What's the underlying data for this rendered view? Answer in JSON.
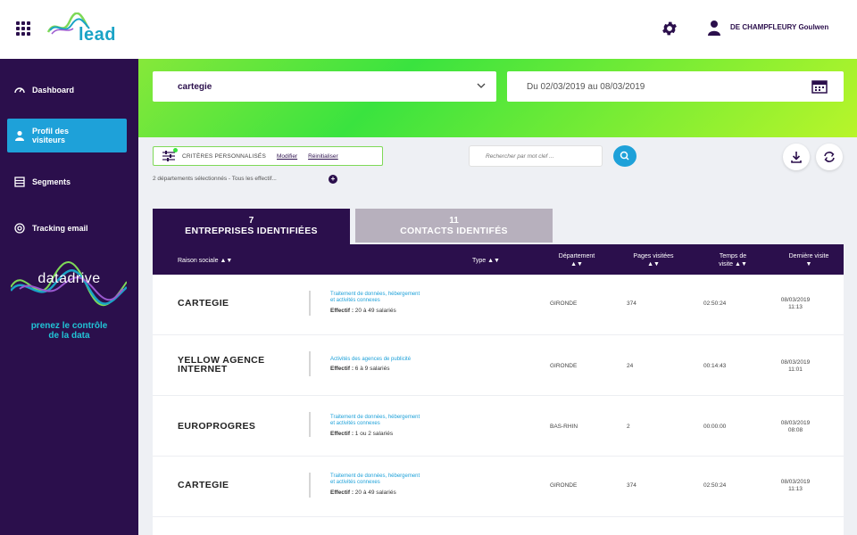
{
  "header": {
    "logo_text": "lead",
    "user_name": "DE CHAMPFLEURY Goulwen"
  },
  "sidebar": {
    "items": [
      {
        "label": "Dashboard",
        "icon": "gauge-icon"
      },
      {
        "label": "Profil des visiteurs",
        "icon": "user-icon",
        "active": true
      },
      {
        "label": "Segments",
        "icon": "segments-icon"
      },
      {
        "label": "Tracking email",
        "icon": "at-icon"
      }
    ],
    "brand": "datadrive",
    "tagline_1": "prenez le contrôle",
    "tagline_2": "de la data"
  },
  "filters": {
    "company_select": "cartegie",
    "date_range": "Du 02/03/2019 au 08/03/2019",
    "criteria_label": "CRITÈRES PERSONNALISÉS",
    "modify": "Modifier",
    "reset": "Réinitialiser",
    "summary": "2 départements sélectionnés - Tous les effectif...",
    "search_placeholder": "Rechercher par mot clef ..."
  },
  "tabs": [
    {
      "count": "7",
      "label": "ENTREPRISES IDENTIFIÉES",
      "active": true
    },
    {
      "count": "11",
      "label": "CONTACTS IDENTIFÉS",
      "active": false
    }
  ],
  "table": {
    "headers": {
      "name": "Raison sociale ▲▼",
      "type": "Type ▲▼",
      "dept_1": "Département",
      "dept_2": "▲▼",
      "pages_1": "Pages visitées",
      "pages_2": "▲▼",
      "time_1": "Temps de",
      "time_2": "visite ▲▼",
      "last_1": "Dernière visite",
      "last_2": "▼"
    },
    "effectif_label": "Effectif :",
    "rows": [
      {
        "name_1": "CARTEGIE",
        "name_2": "",
        "sector_1": "Traitement de données, hébergement",
        "sector_2": "et activités connexes",
        "effectif": " 20 à 49 salariés",
        "dept": "GIRONDE",
        "pages": "374",
        "time": "02:50:24",
        "date": "08/03/2019",
        "hour": "11:13"
      },
      {
        "name_1": "YELLOW AGENCE",
        "name_2": "INTERNET",
        "sector_1": "Activités des agences de publicité",
        "sector_2": "",
        "effectif": " 6 à 9 salariés",
        "dept": "GIRONDE",
        "pages": "24",
        "time": "00:14:43",
        "date": "08/03/2019",
        "hour": "11:01"
      },
      {
        "name_1": "EUROPROGRES",
        "name_2": "",
        "sector_1": "Traitement de données, hébergement",
        "sector_2": "et activités connexes",
        "effectif": " 1 ou 2 salariés",
        "dept": "BAS-RHIN",
        "pages": "2",
        "time": "00:00:00",
        "date": "08/03/2019",
        "hour": "08:08"
      },
      {
        "name_1": "CARTEGIE",
        "name_2": "",
        "sector_1": "Traitement de données, hébergement",
        "sector_2": "et activités connexes",
        "effectif": " 20 à 49 salariés",
        "dept": "GIRONDE",
        "pages": "374",
        "time": "02:50:24",
        "date": "08/03/2019",
        "hour": "11:13"
      }
    ]
  },
  "colors": {
    "primary": "#2b0f4c",
    "accent": "#1ea1d9",
    "green": "#3ae33f"
  }
}
